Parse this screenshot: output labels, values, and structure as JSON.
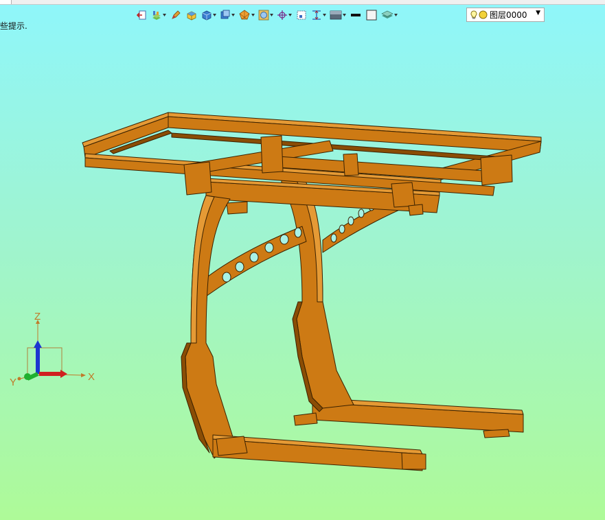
{
  "hint_text": "些提示.",
  "toolbar": {
    "items": [
      {
        "icon": "exit-icon",
        "dropdown": false
      },
      {
        "icon": "layer-manager-icon",
        "dropdown": true
      },
      {
        "icon": "pen-icon",
        "dropdown": false
      },
      {
        "icon": "shaded-block-icon",
        "dropdown": false
      },
      {
        "icon": "cube-icon",
        "dropdown": true
      },
      {
        "icon": "view-cube-icon",
        "dropdown": true
      },
      {
        "icon": "render-mode-icon",
        "dropdown": true
      },
      {
        "icon": "display-filter-icon",
        "dropdown": true
      },
      {
        "icon": "snap-icon",
        "dropdown": true
      },
      {
        "icon": "select-window-icon",
        "dropdown": false
      },
      {
        "icon": "dimension-icon",
        "dropdown": true
      },
      {
        "icon": "background-icon",
        "dropdown": true
      },
      {
        "icon": "line-weight-icon",
        "dropdown": false
      },
      {
        "icon": "empty-square-icon",
        "dropdown": false
      },
      {
        "icon": "layers-icon",
        "dropdown": true
      }
    ]
  },
  "layer": {
    "current": "图层0000"
  },
  "triad": {
    "x_label": "X",
    "y_label": "Y",
    "z_label": "Z"
  },
  "colors": {
    "model": "#cd7a14",
    "model_dark": "#8a4d05",
    "model_light": "#e59a35",
    "outline": "#3a2100"
  }
}
